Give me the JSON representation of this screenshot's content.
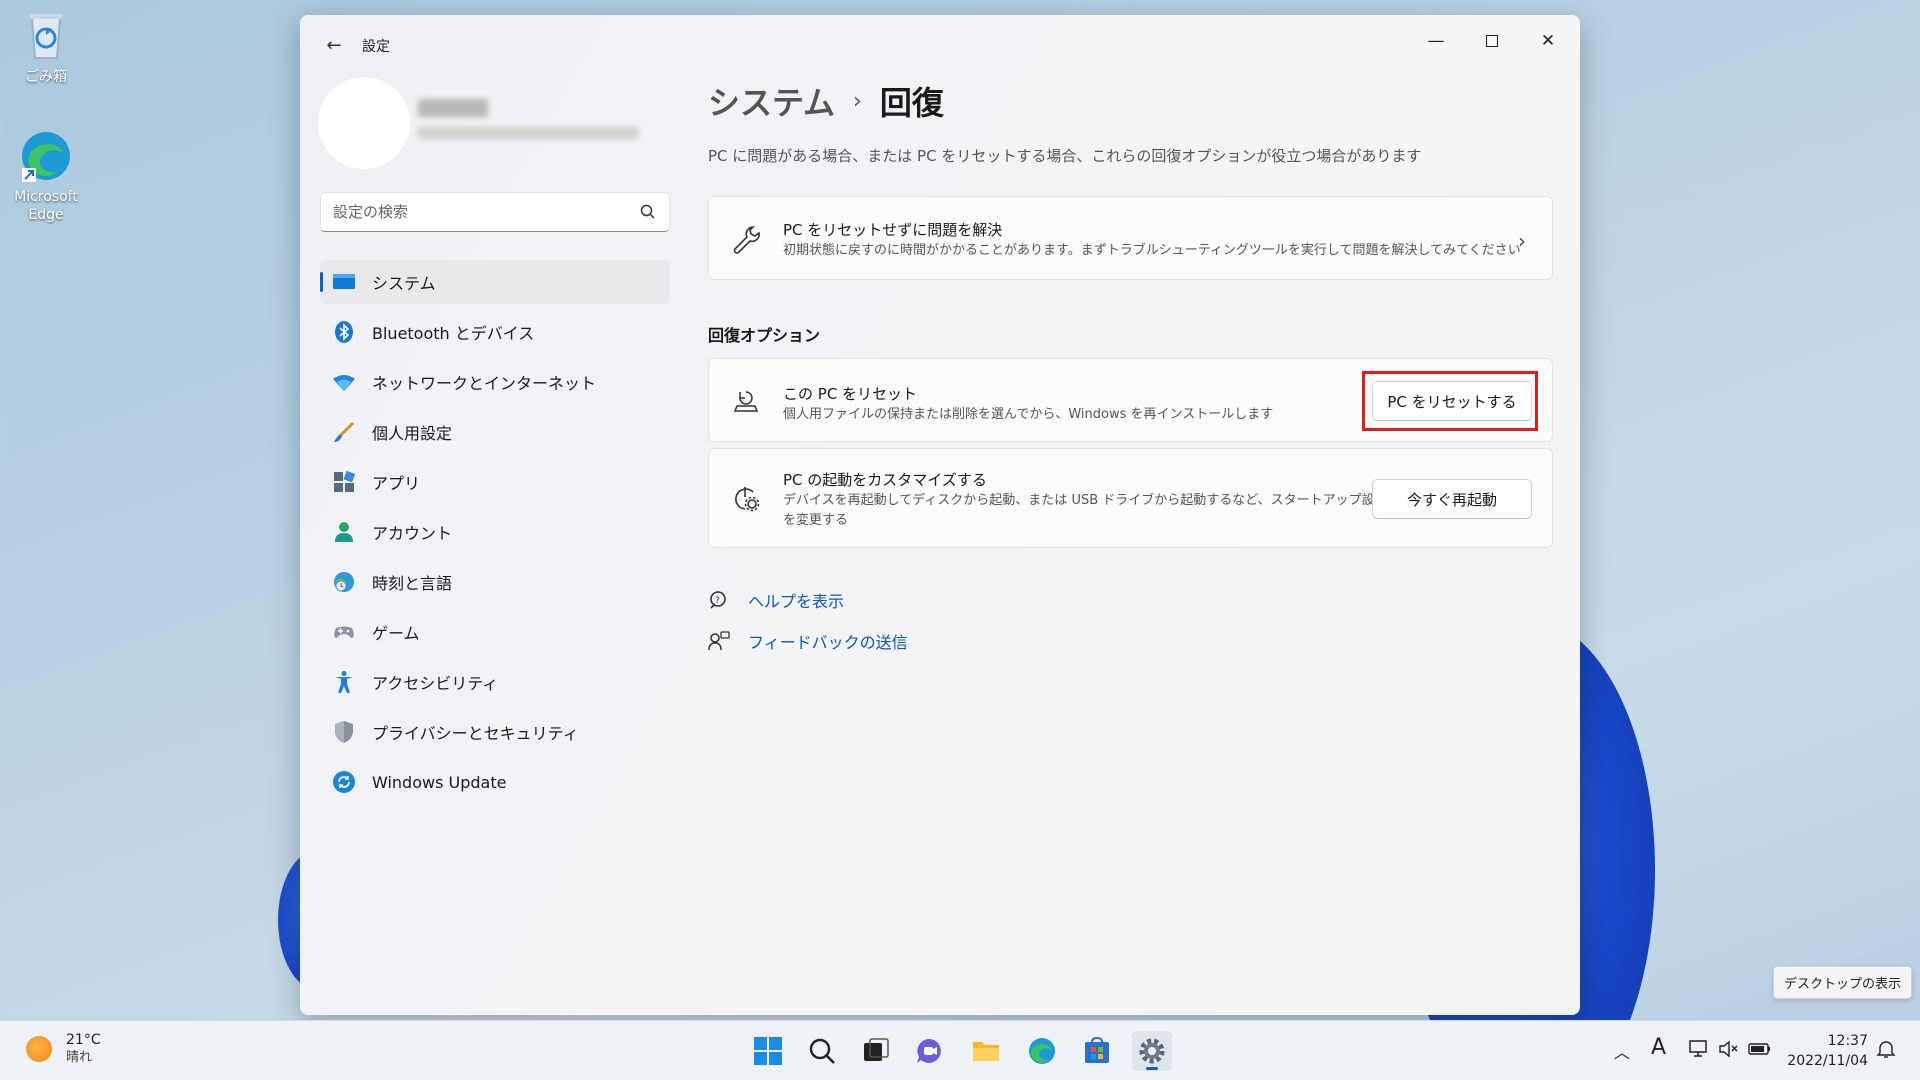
{
  "desktop": {
    "icons": [
      {
        "label": "ごみ箱"
      },
      {
        "label": "Microsoft Edge"
      }
    ],
    "show_desktop_tooltip": "デスクトップの表示"
  },
  "window": {
    "title": "設定",
    "search_placeholder": "設定の検索",
    "nav": [
      {
        "label": "システム",
        "icon": "system-icon",
        "active": true
      },
      {
        "label": "Bluetooth とデバイス",
        "icon": "bluetooth-icon"
      },
      {
        "label": "ネットワークとインターネット",
        "icon": "wifi-icon"
      },
      {
        "label": "個人用設定",
        "icon": "brush-icon"
      },
      {
        "label": "アプリ",
        "icon": "apps-icon"
      },
      {
        "label": "アカウント",
        "icon": "account-icon"
      },
      {
        "label": "時刻と言語",
        "icon": "globe-clock-icon"
      },
      {
        "label": "ゲーム",
        "icon": "gamepad-icon"
      },
      {
        "label": "アクセシビリティ",
        "icon": "accessibility-icon"
      },
      {
        "label": "プライバシーとセキュリティ",
        "icon": "shield-icon"
      },
      {
        "label": "Windows Update",
        "icon": "update-icon"
      }
    ],
    "breadcrumb": {
      "parent": "システム",
      "separator": "›",
      "current": "回復"
    },
    "description": "PC に問題がある場合、または PC をリセットする場合、これらの回復オプションが役立つ場合があります",
    "troubleshoot_card": {
      "title": "PC をリセットせずに問題を解決",
      "subtitle": "初期状態に戻すのに時間がかかることがあります。まずトラブルシューティングツールを実行して問題を解決してみてください"
    },
    "recovery_options_title": "回復オプション",
    "reset_card": {
      "title": "この PC をリセット",
      "subtitle": "個人用ファイルの保持または削除を選んでから、Windows を再インストールします",
      "button": "PC をリセットする"
    },
    "startup_card": {
      "title": "PC の起動をカスタマイズする",
      "subtitle_line1": "デバイスを再起動してディスクから起動、または USB ドライブから起動するなど、スタートアップ設定",
      "subtitle_line2": "を変更する",
      "button": "今すぐ再起動"
    },
    "links": [
      {
        "label": "ヘルプを表示",
        "icon": "help-icon"
      },
      {
        "label": "フィードバックの送信",
        "icon": "feedback-icon"
      }
    ]
  },
  "taskbar": {
    "weather_temp": "21°C",
    "weather_condition": "晴れ",
    "tray_ime": "A",
    "clock_time": "12:37",
    "clock_date": "2022/11/04"
  },
  "colors": {
    "accent": "#0067c0",
    "highlight_box": "#e11c1c",
    "link": "#0a58b8"
  }
}
